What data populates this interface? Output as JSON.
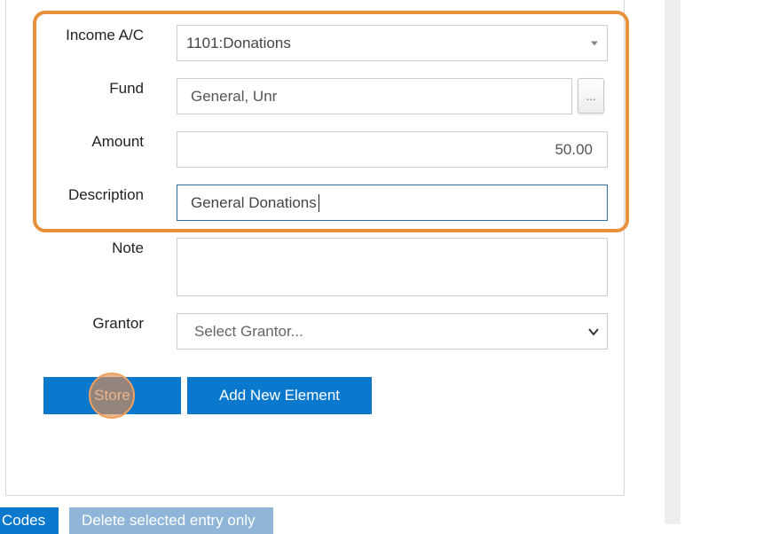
{
  "form": {
    "income_ac": {
      "label": "Income A/C",
      "value": "1101:Donations"
    },
    "fund": {
      "label": "Fund",
      "value": "General, Unr",
      "lookup_label": "..."
    },
    "amount": {
      "label": "Amount",
      "value": "50.00"
    },
    "description": {
      "label": "Description",
      "value": "General Donations"
    },
    "note": {
      "label": "Note",
      "value": ""
    },
    "grantor": {
      "label": "Grantor",
      "placeholder": "Select Grantor..."
    }
  },
  "buttons": {
    "store": "Store",
    "add_new_element": "Add New Element"
  },
  "footer": {
    "codes_button": "Codes",
    "delete_button": "Delete selected entry only"
  },
  "colors": {
    "primary_button": "#0a78cd",
    "disabled_button": "#8fb6d9",
    "highlight": "#e8913d"
  }
}
